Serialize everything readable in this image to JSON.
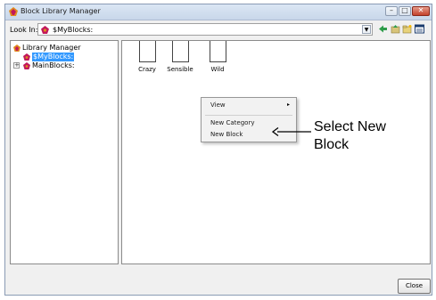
{
  "window": {
    "title": "Block Library Manager",
    "title_icon": "library-icon",
    "controls": {
      "minimize": "–",
      "maximize": "□",
      "close": "✕"
    }
  },
  "toolbar": {
    "lookin_label": "Look In:",
    "lookin_value": "$MyBlocks:",
    "lookin_icon": "block-folder-icon",
    "icons": [
      "back-arrow-icon",
      "up-folder-icon",
      "new-folder-icon",
      "view-menu-icon"
    ]
  },
  "tree": {
    "root": {
      "label": "Library Manager",
      "icon": "library-icon"
    },
    "items": [
      {
        "label": "$MyBlocks:",
        "icon": "block-folder-icon",
        "selected": true
      },
      {
        "label": "MainBlocks:",
        "icon": "block-folder-icon",
        "selected": false,
        "expander": "+"
      }
    ]
  },
  "content": {
    "folders": [
      {
        "label": "Crazy"
      },
      {
        "label": "Sensible"
      },
      {
        "label": "Wild"
      }
    ]
  },
  "context_menu": {
    "items": [
      "View",
      "New Category",
      "New Block"
    ],
    "submenu_arrow": "▸"
  },
  "annotation": {
    "text": "Select New Block"
  },
  "buttons": {
    "close": "Close"
  },
  "colors": {
    "selection": "#3399ff",
    "icon_magenta": "#c2185b",
    "icon_orange": "#e08a1e",
    "toolbar_green": "#2e9c4a"
  }
}
